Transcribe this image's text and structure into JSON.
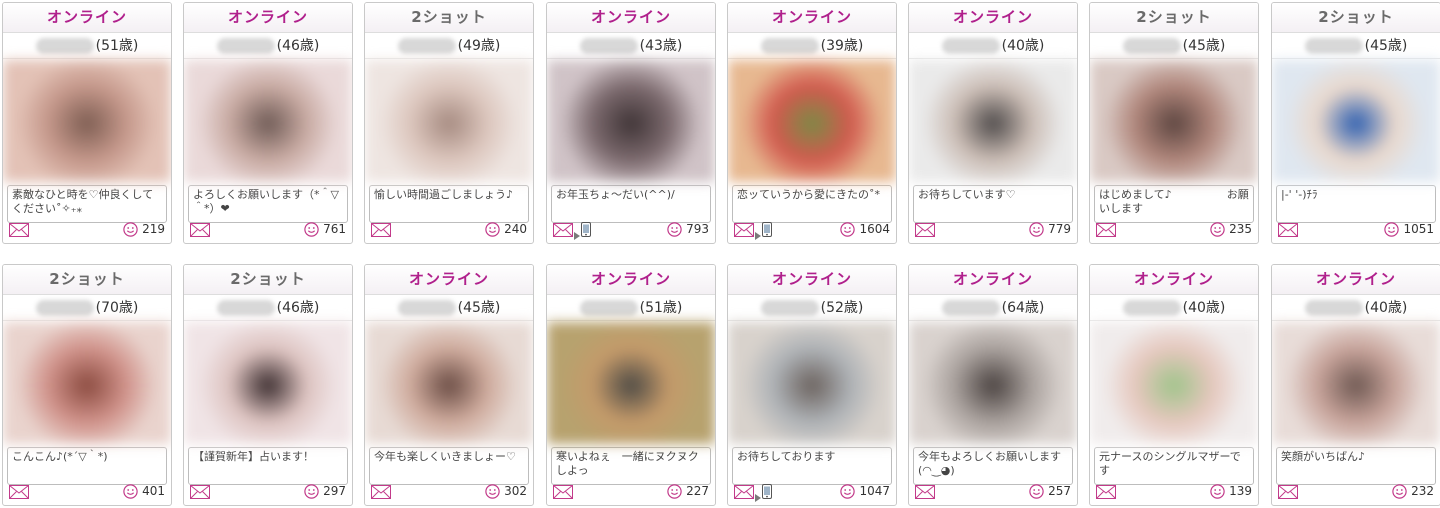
{
  "status_labels": {
    "online": "オンライン",
    "twoshot": "2ショット"
  },
  "colors": {
    "online": "#b0208c",
    "twoshot": "#6a6a6a",
    "smile": "#c23a8a"
  },
  "icons": {
    "mail": "mail-icon",
    "phone": "phone-icon",
    "smile": "smile-icon"
  },
  "cards": [
    {
      "status": "online",
      "age": "(51歳)",
      "message": "素敵なひと時を♡仲良くしてください˚✧₊⁎",
      "count": "219",
      "phone": false,
      "photo": [
        "#c4978a",
        "#7d5d52",
        "#e3c2b6"
      ]
    },
    {
      "status": "online",
      "age": "(46歳)",
      "message": "よろしくお願いします（*＾▽＾*）❤",
      "count": "761",
      "phone": false,
      "photo": [
        "#c8aaa2",
        "#6e5a55",
        "#ead9d9"
      ]
    },
    {
      "status": "twoshot",
      "age": "(49歳)",
      "message": "愉しい時間過ごしましょう♪",
      "count": "240",
      "phone": false,
      "photo": [
        "#dcc6bd",
        "#a58a80",
        "#eee5e1"
      ]
    },
    {
      "status": "online",
      "age": "(43歳)",
      "message": "お年玉ちょ～だい(^^)/",
      "count": "793",
      "phone": true,
      "photo": [
        "#7c6a6e",
        "#3f3436",
        "#d0c3c7"
      ]
    },
    {
      "status": "online",
      "age": "(39歳)",
      "message": "恋ッていうから愛にきたの˚*",
      "count": "1604",
      "phone": true,
      "photo": [
        "#d15a4e",
        "#7c8a45",
        "#e7b890"
      ]
    },
    {
      "status": "online",
      "age": "(40歳)",
      "message": "お待ちしています♡",
      "count": "779",
      "phone": false,
      "photo": [
        "#cbbdb5",
        "#4e4a4a",
        "#eaeaea"
      ]
    },
    {
      "status": "twoshot",
      "age": "(45歳)",
      "message": "はじめまして♪　　　　　お願いします",
      "count": "235",
      "phone": false,
      "photo": [
        "#b0867b",
        "#5c4540",
        "#d9c9c4"
      ]
    },
    {
      "status": "twoshot",
      "age": "(45歳)",
      "message": "|-' '-)ﾁﾗ",
      "count": "1051",
      "phone": false,
      "photo": [
        "#e9d8cc",
        "#2b5db0",
        "#dfe7f0"
      ]
    },
    {
      "status": "twoshot",
      "age": "(70歳)",
      "message": "こんこん♪(*´▽｀*)",
      "count": "401",
      "phone": false,
      "photo": [
        "#d0928a",
        "#8a4a3f",
        "#e9d3cd"
      ]
    },
    {
      "status": "twoshot",
      "age": "(46歳)",
      "message": "【謹賀新年】占います！",
      "count": "297",
      "phone": false,
      "photo": [
        "#ddc3c0",
        "#3a2c2e",
        "#f0e4e6"
      ]
    },
    {
      "status": "online",
      "age": "(45歳)",
      "message": "今年も楽しくいきましょー♡",
      "count": "302",
      "phone": false,
      "photo": [
        "#cfab9d",
        "#6a4c44",
        "#e7dad4"
      ]
    },
    {
      "status": "online",
      "age": "(51歳)",
      "message": "寒いよねぇ　一緒にヌクヌクしよっ",
      "count": "227",
      "phone": false,
      "photo": [
        "#c49a6a",
        "#4d4a45",
        "#b7a26e"
      ]
    },
    {
      "status": "online",
      "age": "(52歳)",
      "message": "お待ちしております",
      "count": "1047",
      "phone": true,
      "photo": [
        "#aeb2b6",
        "#6b625e",
        "#d8d2cc"
      ]
    },
    {
      "status": "online",
      "age": "(64歳)",
      "message": "今年もよろしくお願いします(◠‿◕)",
      "count": "257",
      "phone": false,
      "photo": [
        "#a9a19d",
        "#4a4240",
        "#d9d2ce"
      ]
    },
    {
      "status": "online",
      "age": "(40歳)",
      "message": "元ナースのシングルマザーです",
      "count": "139",
      "phone": false,
      "photo": [
        "#e5c7bd",
        "#9fc48a",
        "#f0ecec"
      ]
    },
    {
      "status": "online",
      "age": "(40歳)",
      "message": "笑顔がいちばん♪",
      "count": "232",
      "phone": false,
      "photo": [
        "#c7a39a",
        "#6e5852",
        "#e8dcd8"
      ]
    }
  ]
}
